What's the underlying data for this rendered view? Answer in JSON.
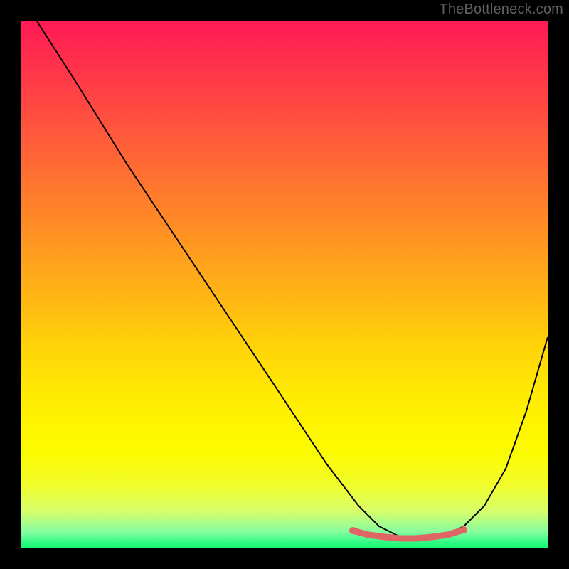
{
  "watermark": "TheBottleneck.com",
  "chart_data": {
    "type": "line",
    "title": "",
    "xlabel": "",
    "ylabel": "",
    "xlim": [
      0,
      100
    ],
    "ylim": [
      0,
      100
    ],
    "series": [
      {
        "name": "main-curve",
        "color": "#000000",
        "stroke_width": 2,
        "x_norm": [
          3,
          10,
          20,
          30,
          40,
          50,
          58,
          64,
          68,
          72,
          76,
          80,
          84,
          88,
          92,
          96,
          100
        ],
        "y_norm": [
          100,
          89,
          73,
          58,
          43,
          28,
          16,
          8,
          4,
          2,
          2,
          2,
          4,
          8,
          15,
          26,
          40
        ]
      },
      {
        "name": "bottom-marker",
        "color": "#e06666",
        "stroke_width": 8,
        "x_norm": [
          63,
          66,
          69,
          72,
          75,
          78,
          81,
          84
        ],
        "y_norm": [
          3.2,
          2.4,
          2.0,
          1.8,
          1.8,
          2.0,
          2.4,
          3.4
        ]
      }
    ],
    "gradient_note": "Background vertical gradient red→orange→yellow→green represents bottleneck severity (top=worst, bottom=best). Curve minimum ≈ x 74–78."
  }
}
